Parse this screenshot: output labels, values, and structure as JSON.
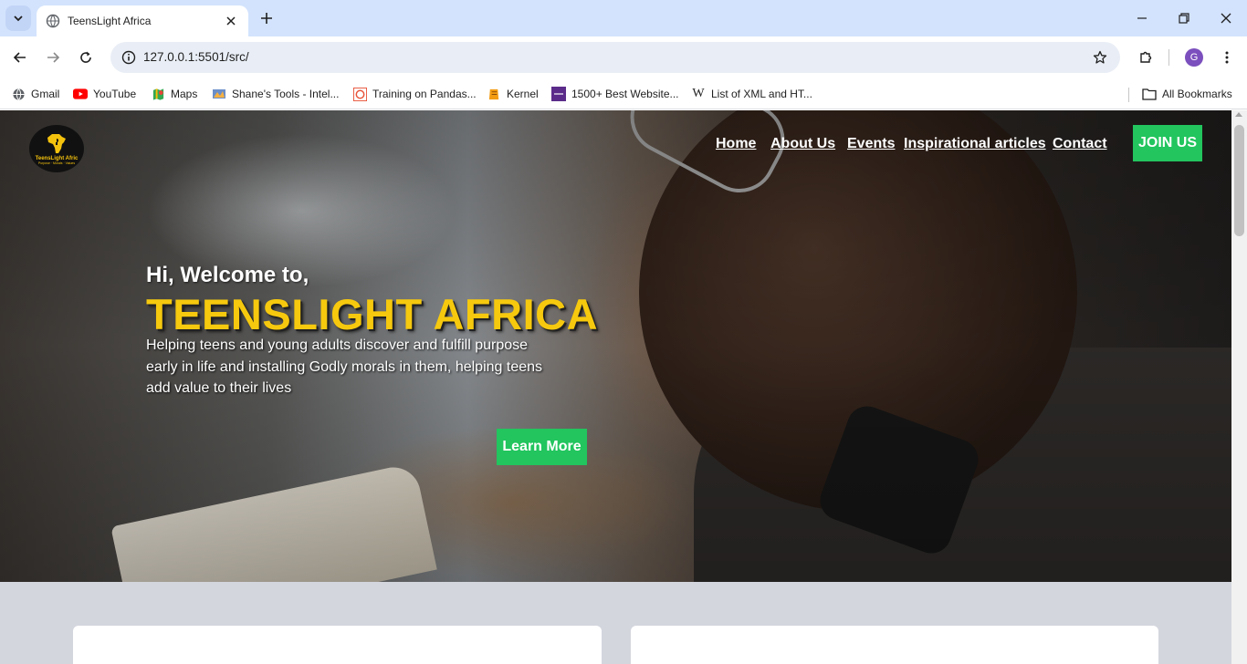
{
  "browser": {
    "tab_title": "TeensLight Africa",
    "url": "127.0.0.1:5501/src/",
    "profile_initial": "G",
    "bookmarks": [
      {
        "label": "Gmail",
        "icon": "globe-icon"
      },
      {
        "label": "YouTube",
        "icon": "youtube-icon"
      },
      {
        "label": "Maps",
        "icon": "maps-icon"
      },
      {
        "label": "Shane's Tools - Intel...",
        "icon": "tools-icon"
      },
      {
        "label": "Training on Pandas...",
        "icon": "training-icon"
      },
      {
        "label": "Kernel",
        "icon": "kernel-icon"
      },
      {
        "label": "1500+ Best Website...",
        "icon": "colorlib-icon"
      },
      {
        "label": "List of XML and HT...",
        "icon": "wikipedia-icon"
      }
    ],
    "all_bookmarks": "All Bookmarks"
  },
  "site": {
    "logo_text": "TeensLight Afric",
    "logo_tagline": "Purpose · Morals · Values",
    "nav": [
      "Home",
      "About Us",
      "Events",
      "Inspirational articles",
      "Contact"
    ],
    "join_label": "JOIN US",
    "hero": {
      "welcome": "Hi, Welcome to,",
      "title": "TEENSLIGHT AFRICA",
      "description": "Helping teens and young adults discover and fulfill purpose early in life and installing Godly morals in them, helping teens add value to their lives",
      "cta": "Learn More"
    }
  },
  "colors": {
    "accent_green": "#22c55e",
    "title_yellow": "#f6c90e",
    "tabstrip": "#d3e3fd",
    "page_bg": "#d4d6de"
  }
}
